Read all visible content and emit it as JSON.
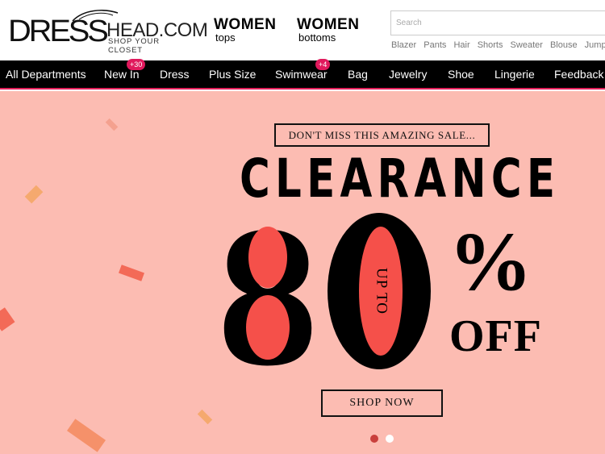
{
  "brand": {
    "logo_main": "DRESS",
    "logo_domain": "HEAD.COM",
    "tagline": "SHOP YOUR CLOSET"
  },
  "header": {
    "promos": [
      {
        "title": "WOMEN",
        "subtitle": "tops"
      },
      {
        "title": "WOMEN",
        "subtitle": "bottoms"
      }
    ],
    "search": {
      "placeholder": "Search"
    },
    "quick_links": [
      "Blazer",
      "Pants",
      "Hair",
      "Shorts",
      "Sweater",
      "Blouse",
      "Jumpsu"
    ]
  },
  "nav": {
    "items": [
      {
        "label": "All Departments"
      },
      {
        "label": "New In",
        "badge": "+30"
      },
      {
        "label": "Dress"
      },
      {
        "label": "Plus Size"
      },
      {
        "label": "Swimwear",
        "badge": "+4"
      },
      {
        "label": "Bag"
      },
      {
        "label": "Jewelry"
      },
      {
        "label": "Shoe"
      },
      {
        "label": "Lingerie"
      },
      {
        "label": "Feedback"
      }
    ]
  },
  "banner": {
    "tagline": "DON'T MISS THIS AMAZING SALE...",
    "headline": "CLEARANCE",
    "digit_1": "8",
    "digit_2": "0",
    "inner_text": "UP TO",
    "percent": "%",
    "off": "OFF",
    "cta": "SHOP NOW",
    "slides": 2,
    "active_slide": 1
  },
  "colors": {
    "banner_bg": "#fcbcb2",
    "accent_red": "#f5504a",
    "nav_bg": "#000000",
    "nav_border": "#e21f5a",
    "badge": "#e0195c",
    "confetti": "#f5916a"
  }
}
